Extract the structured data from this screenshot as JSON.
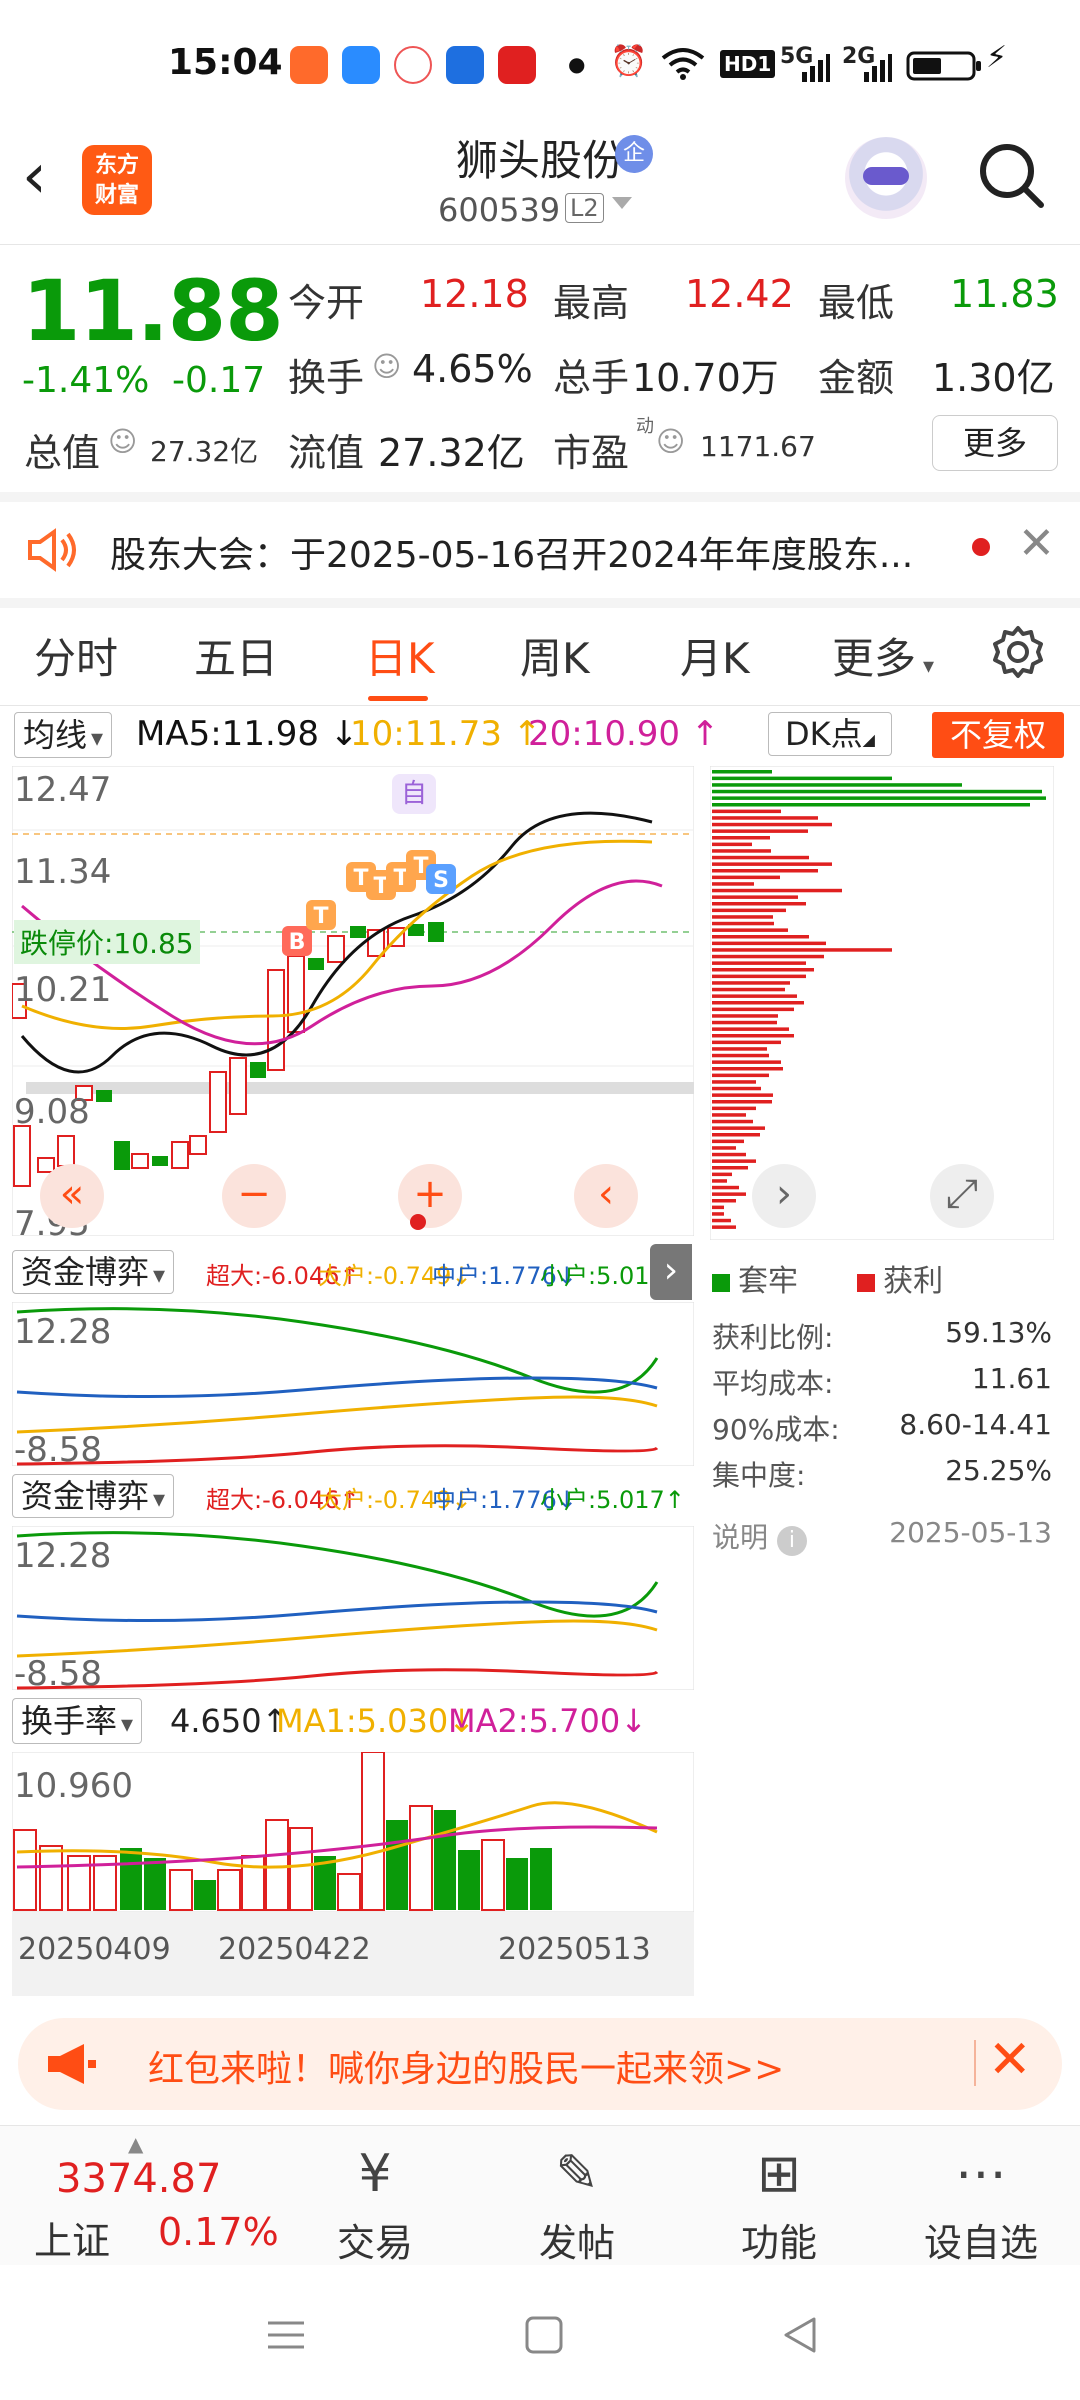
{
  "status_bar": {
    "time": "15:04",
    "signal_5g": "5G",
    "signal_2g": "2G",
    "hd": "HD1"
  },
  "header": {
    "logo_line1": "东方",
    "logo_line2": "财富",
    "stock_name": "狮头股份",
    "enterprise_badge": "企",
    "stock_code": "600539",
    "level_badge": "L2"
  },
  "quote": {
    "price": "11.88",
    "change_pct": "-1.41%",
    "change_amt": "-0.17",
    "open_label": "今开",
    "open": "12.18",
    "high_label": "最高",
    "high": "12.42",
    "low_label": "最低",
    "low": "11.83",
    "turnover_label": "换手",
    "turnover": "4.65%",
    "volume_label": "总手",
    "volume": "10.70万",
    "amount_label": "金额",
    "amount": "1.30亿",
    "total_mv_label": "总值",
    "total_mv": "27.32亿",
    "float_mv_label": "流值",
    "float_mv": "27.32亿",
    "pe_label": "市盈",
    "pe_sup": "动",
    "pe": "1171.67",
    "more_label": "更多"
  },
  "notice": {
    "text": "股东大会：于2025-05-16召开2024年年度股东..."
  },
  "tabs": [
    "分时",
    "五日",
    "日K",
    "周K",
    "月K",
    "更多"
  ],
  "active_tab": "日K",
  "kline": {
    "indicator": "均线",
    "ma5": "MA5:11.98 ↓",
    "ma10": "10:11.73 ↑",
    "ma20": "20:10.90 ↑",
    "dk_label": "DK点",
    "adjust_label": "不复权",
    "y_labels": [
      "12.47",
      "11.34",
      "10.21",
      "9.08",
      "7.95"
    ],
    "stop_price_label": "跌停价:10.85",
    "self_tag": "自",
    "colors": {
      "up": "#e02020",
      "down": "#0a9a0a",
      "ma5": "#111111",
      "ma10": "#f0b000",
      "ma20": "#d0209a"
    }
  },
  "fund_flow": {
    "indicator": "资金博弈",
    "super": "超大:-6.046↑",
    "big": "大户:-0.749↓",
    "mid": "中户:1.776↓",
    "small": "小户:5.017↑",
    "y_top": "12.28",
    "y_bottom": "-8.58"
  },
  "turnover_chart": {
    "indicator": "换手率",
    "value": "4.650↑",
    "ma1": "MA1:5.030↓",
    "ma2": "MA2:5.700↓",
    "y_top": "10.960",
    "dates": [
      "20250409",
      "20250422",
      "20250513"
    ]
  },
  "chips": {
    "legend_trapped": "套牢",
    "legend_profit": "获利",
    "stats": [
      {
        "label": "获利比例:",
        "value": "59.13%"
      },
      {
        "label": "平均成本:",
        "value": "11.61"
      },
      {
        "label": "90%成本:",
        "value": "8.60-14.41"
      },
      {
        "label": "集中度:",
        "value": "25.25%"
      }
    ],
    "note_label": "说明",
    "date": "2025-05-13"
  },
  "banner": {
    "text": "红包来啦！喊你身边的股民一起来领>>"
  },
  "bottom_nav": {
    "index_value": "3374.87",
    "index_name": "上证",
    "index_change": "0.17%",
    "items": [
      {
        "label": "交易",
        "icon": "yen-circle-icon"
      },
      {
        "label": "发帖",
        "icon": "edit-icon"
      },
      {
        "label": "功能",
        "icon": "grid-icon"
      },
      {
        "label": "设自选",
        "icon": "dots-icon"
      }
    ]
  }
}
